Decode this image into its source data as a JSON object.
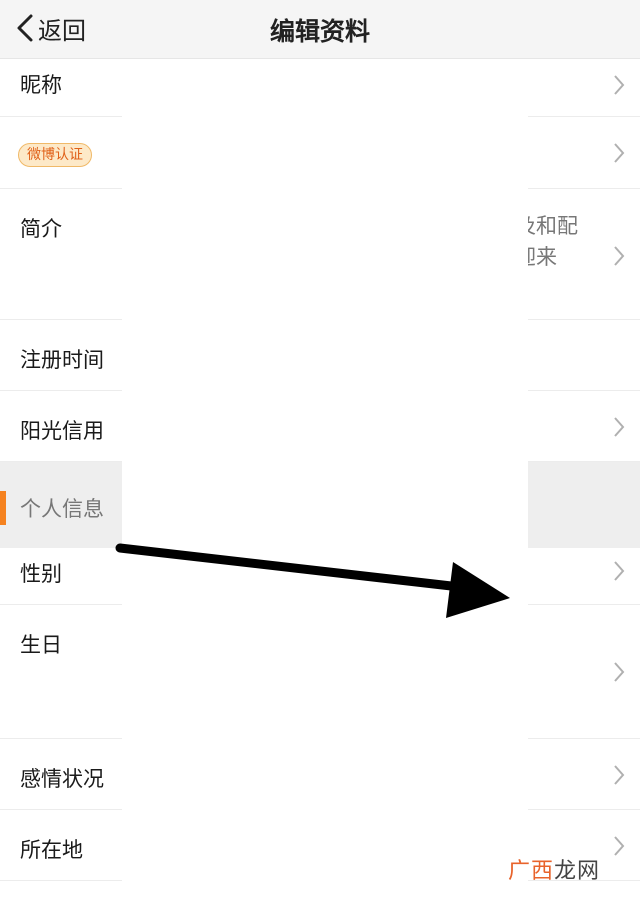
{
  "navbar": {
    "back_label": "返回",
    "title": "编辑资料"
  },
  "rows": {
    "nickname": {
      "label": "昵称"
    },
    "weibo_verify": {
      "badge": "微博认证"
    },
    "intro": {
      "label": "简介",
      "value_line1": "及和配",
      "value_line2": "迎来"
    },
    "register_time": {
      "label": "注册时间"
    },
    "credit": {
      "label": "阳光信用"
    },
    "gender": {
      "label": "性别"
    },
    "birthday": {
      "label": "生日"
    },
    "relationship": {
      "label": "感情状况"
    },
    "location": {
      "label": "所在地"
    }
  },
  "section": {
    "label": "个人信息",
    "accent_color": "#f5821f"
  },
  "watermark": {
    "part1": "广西",
    "part2": "龙网"
  }
}
